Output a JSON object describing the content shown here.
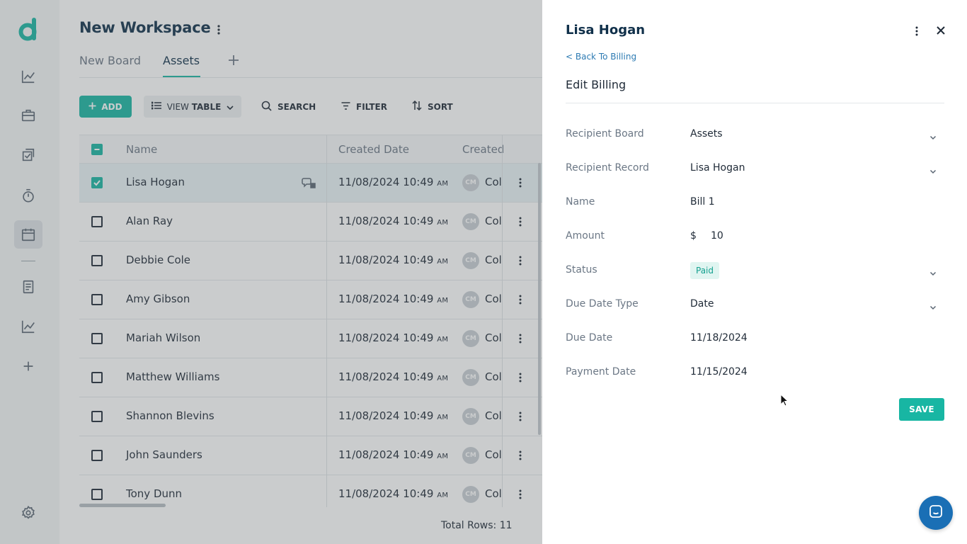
{
  "workspace": {
    "title": "New Workspace"
  },
  "tabs": [
    {
      "label": "New Board",
      "active": false
    },
    {
      "label": "Assets",
      "active": true
    }
  ],
  "toolbar": {
    "add_label": "ADD",
    "view_label_prefix": "VIEW",
    "view_label_bold": "TABLE",
    "search_label": "SEARCH",
    "filter_label": "FILTER",
    "sort_label": "SORT"
  },
  "table": {
    "columns": [
      "Name",
      "Created Date",
      "Created"
    ],
    "rows": [
      {
        "name": "Lisa Hogan",
        "date": "11/08/2024 10:49",
        "ampm": "AM",
        "initials": "CM",
        "by": "Col",
        "selected": true
      },
      {
        "name": "Alan Ray",
        "date": "11/08/2024 10:49",
        "ampm": "AM",
        "initials": "CM",
        "by": "Col",
        "selected": false
      },
      {
        "name": "Debbie Cole",
        "date": "11/08/2024 10:49",
        "ampm": "AM",
        "initials": "CM",
        "by": "Col",
        "selected": false
      },
      {
        "name": "Amy Gibson",
        "date": "11/08/2024 10:49",
        "ampm": "AM",
        "initials": "CM",
        "by": "Col",
        "selected": false
      },
      {
        "name": "Mariah Wilson",
        "date": "11/08/2024 10:49",
        "ampm": "AM",
        "initials": "CM",
        "by": "Col",
        "selected": false
      },
      {
        "name": "Matthew Williams",
        "date": "11/08/2024 10:49",
        "ampm": "AM",
        "initials": "CM",
        "by": "Col",
        "selected": false
      },
      {
        "name": "Shannon Blevins",
        "date": "11/08/2024 10:49",
        "ampm": "AM",
        "initials": "CM",
        "by": "Col",
        "selected": false
      },
      {
        "name": "John Saunders",
        "date": "11/08/2024 10:49",
        "ampm": "AM",
        "initials": "CM",
        "by": "Col",
        "selected": false
      },
      {
        "name": "Tony Dunn",
        "date": "11/08/2024 10:49",
        "ampm": "AM",
        "initials": "CM",
        "by": "Col",
        "selected": false
      }
    ],
    "total_rows": "Total Rows: 11"
  },
  "panel": {
    "title": "Lisa Hogan",
    "back_link": "< Back To Billing",
    "heading": "Edit Billing",
    "fields": {
      "recipient_board": {
        "label": "Recipient Board",
        "value": "Assets"
      },
      "recipient_record": {
        "label": "Recipient Record",
        "value": "Lisa Hogan"
      },
      "name": {
        "label": "Name",
        "value": "Bill 1"
      },
      "amount": {
        "label": "Amount",
        "currency": "$",
        "value": "10"
      },
      "status": {
        "label": "Status",
        "value": "Paid"
      },
      "due_date_type": {
        "label": "Due Date Type",
        "value": "Date"
      },
      "due_date": {
        "label": "Due Date",
        "value": "11/18/2024"
      },
      "payment_date": {
        "label": "Payment Date",
        "value": "11/15/2024"
      }
    },
    "save_label": "SAVE"
  },
  "colors": {
    "accent": "#18b6a3",
    "navy": "#10304a",
    "link": "#2d7bb3",
    "chat": "#1a6fb5"
  },
  "icons": {
    "sidebar": [
      "analytics-icon",
      "briefcase-icon",
      "tasks-icon",
      "timer-icon",
      "calendar-icon",
      "document-icon",
      "reports-icon",
      "add-icon",
      "settings-icon"
    ]
  }
}
